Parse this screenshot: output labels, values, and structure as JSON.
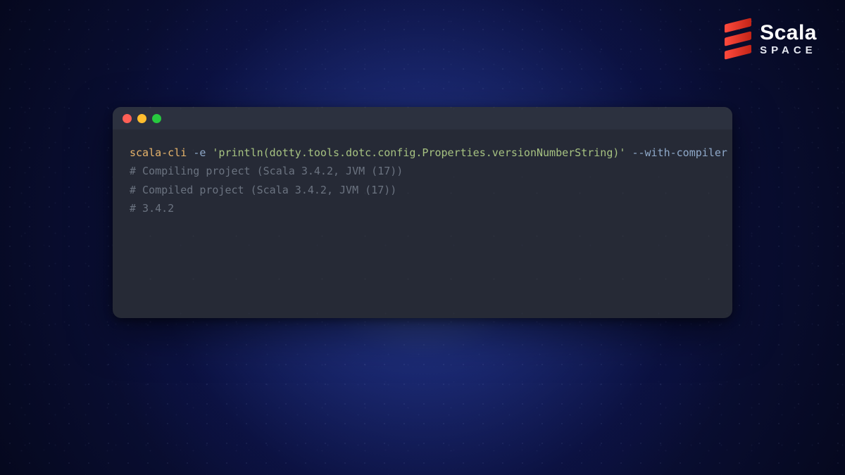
{
  "brand": {
    "title": "Scala",
    "subtitle": "SPACE"
  },
  "terminal": {
    "command": {
      "exe": "scala-cli",
      "flag1": "-e",
      "arg": "'println(dotty.tools.dotc.config.Properties.versionNumberString)'",
      "flag2": "--with-compiler"
    },
    "output": [
      "# Compiling project (Scala 3.4.2, JVM (17))",
      "# Compiled project (Scala 3.4.2, JVM (17))",
      "# 3.4.2"
    ]
  }
}
